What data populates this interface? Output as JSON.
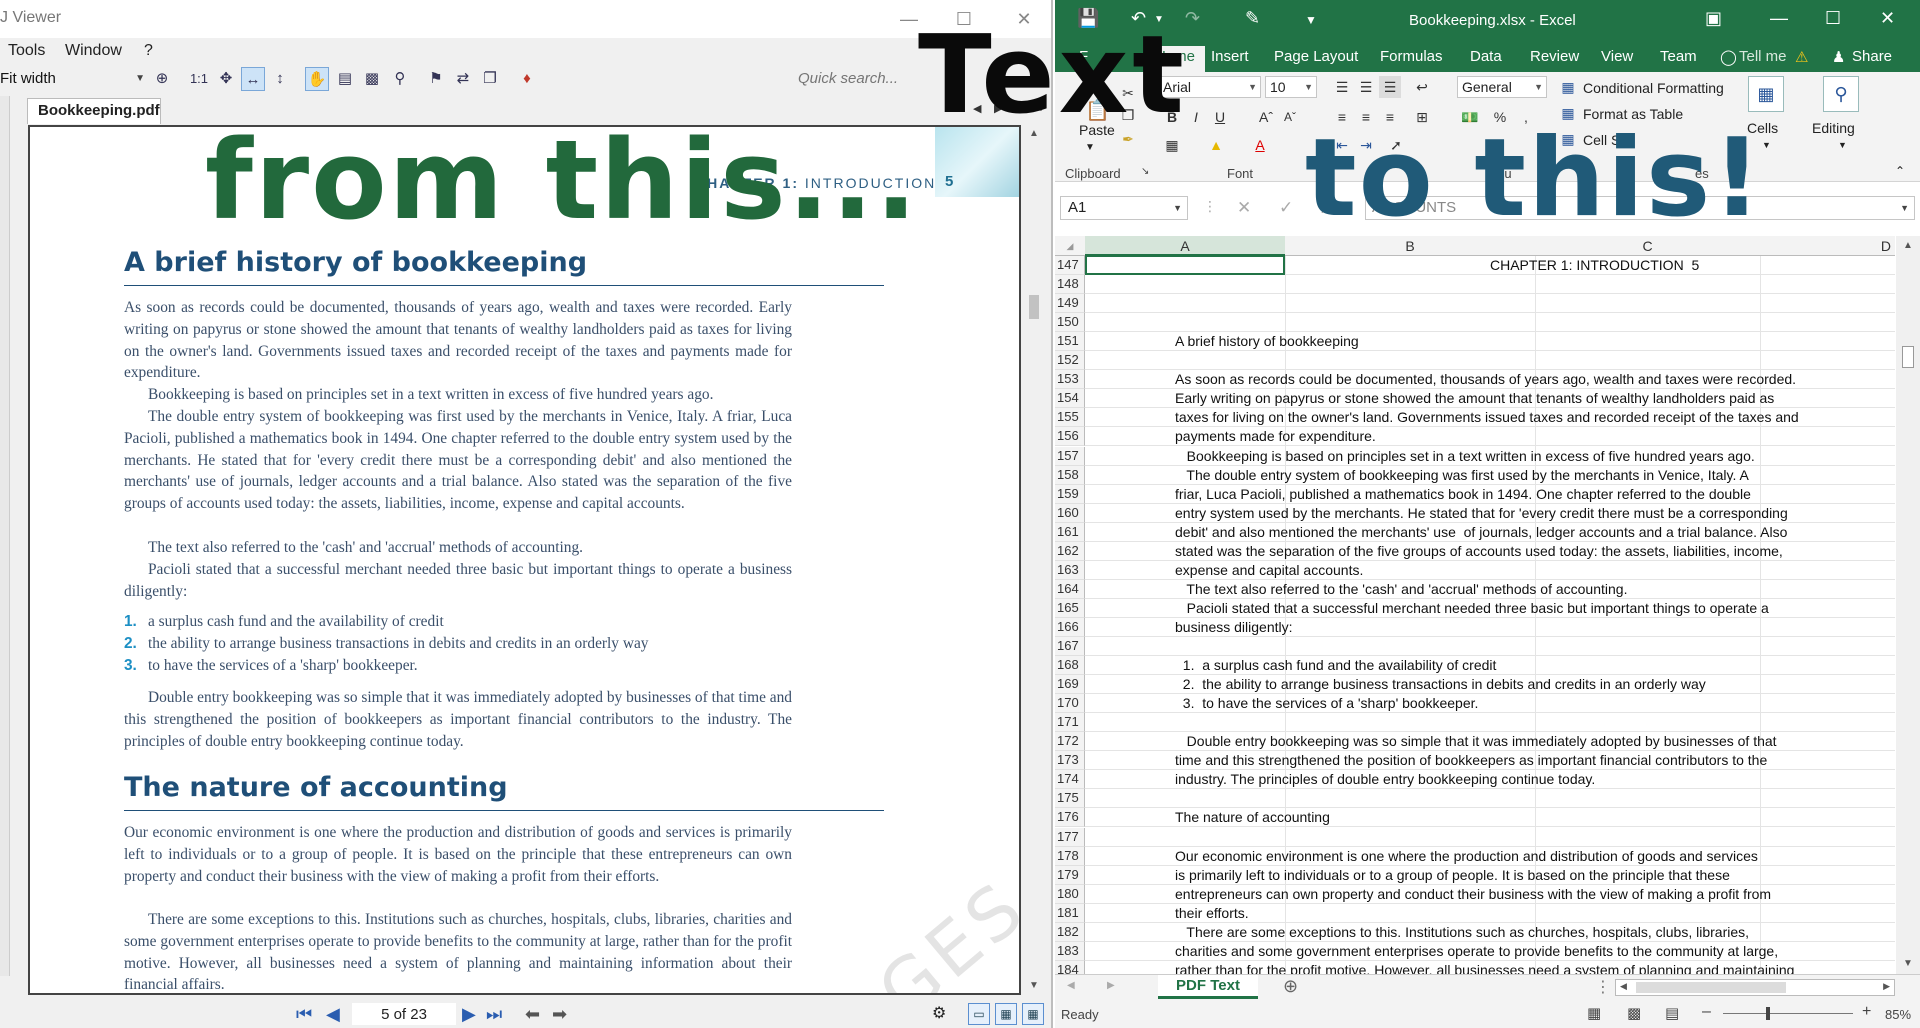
{
  "pdf_viewer": {
    "title": "J Viewer",
    "menu": [
      "Tools",
      "Window",
      "?"
    ],
    "zoom_mode": "Fit width",
    "zoom_ratio": "1:1",
    "search_placeholder": "Quick search...",
    "tab": "Bookkeeping.pdf",
    "page_indicator": "5 of 23",
    "page": {
      "chapter_label": "CHAPTER 1:",
      "chapter_name": "INTRODUCTION",
      "page_number": "5",
      "heading1": "A brief history of bookkeeping",
      "p1": "As soon as records could be documented, thousands of years ago, wealth and taxes were recorded. Early writing on papyrus or stone showed the amount that tenants of wealthy landholders paid as taxes for living on the owner's land. Governments issued taxes and recorded receipt of the taxes and payments made for expenditure.",
      "p2": "Bookkeeping is based on principles set in a text written in excess of five hundred years ago.",
      "p3": "The double entry system of bookkeeping was first used by the merchants in Venice, Italy. A friar, Luca Pacioli, published a mathematics book in 1494. One chapter referred to the double entry system used by the merchants. He stated that for 'every credit there must be a corresponding debit' and also mentioned the merchants' use of journals, ledger accounts and a trial balance. Also stated was the separation of the five groups of accounts used today: the assets, liabilities, income, expense and capital accounts.",
      "p4": "The text also referred to the 'cash' and 'accrual' methods of accounting.",
      "p5": "Pacioli stated that a successful merchant needed three basic but important things to operate a business diligently:",
      "list": [
        {
          "n": "1.",
          "text": "a surplus cash fund and the availability of credit"
        },
        {
          "n": "2.",
          "text": "the ability to arrange business transactions in debits and credits in an orderly way"
        },
        {
          "n": "3.",
          "text": "to have the services of a 'sharp' bookkeeper."
        }
      ],
      "p6": "Double entry bookkeeping was so simple that it was immediately adopted by businesses of that time and this strengthened the position of bookkeepers as important financial contributors to the industry. The principles of double entry bookkeeping continue today.",
      "heading2": "The nature of accounting",
      "p7": "Our economic environment is one where the production and distribution of goods and services is primarily left to individuals or to a group of people. It is based on the principle that these entrepreneurs can own property and conduct their business with the view of making a profit from their efforts.",
      "p8": "There are some exceptions to this. Institutions such as churches, hospitals, clubs, libraries, charities and some government enterprises operate to provide benefits to the community at large, rather than for the profit motive. However, all businesses need a system of planning and maintaining information about their financial affairs.",
      "watermark": "GES"
    }
  },
  "excel": {
    "filename": "Bookkeeping.xlsx - Excel",
    "tabs": [
      "F",
      "Home",
      "Insert",
      "Page Layout",
      "Formulas",
      "Data",
      "Review",
      "View",
      "Team"
    ],
    "tell_me": "Tell me",
    "share": "Share",
    "ribbon": {
      "paste": "Paste",
      "clipboard": "Clipboard",
      "font_name": "Arial",
      "font_size": "10",
      "font_group": "Font",
      "number_format": "General",
      "number_group_partial": "Nu",
      "conditional_formatting": "Conditional Formatting",
      "format_as_table": "Format as Table",
      "cell_styles": "Cell Styl",
      "styles_group_partial": "es",
      "cells": "Cells",
      "editing": "Editing"
    },
    "name_box": "A1",
    "formula_content": "ACCOUNTS",
    "columns": [
      "A",
      "B",
      "C",
      "D"
    ],
    "rows": [
      {
        "n": "147",
        "text": "CHAPTER 1: INTRODUCTION  5",
        "right": true
      },
      {
        "n": "148",
        "text": ""
      },
      {
        "n": "149",
        "text": ""
      },
      {
        "n": "150",
        "text": ""
      },
      {
        "n": "151",
        "text": "A brief history of bookkeeping"
      },
      {
        "n": "152",
        "text": ""
      },
      {
        "n": "153",
        "text": "As soon as records could be documented, thousands of years ago, wealth and taxes were recorded."
      },
      {
        "n": "154",
        "text": "Early writing on papyrus or stone showed the amount that tenants of wealthy landholders paid as"
      },
      {
        "n": "155",
        "text": "taxes for living on the owner's land. Governments issued taxes and recorded receipt of the taxes and"
      },
      {
        "n": "156",
        "text": "payments made for expenditure."
      },
      {
        "n": "157",
        "text": "   Bookkeeping is based on principles set in a text written in excess of five hundred years ago."
      },
      {
        "n": "158",
        "text": "   The double entry system of bookkeeping was first used by the merchants in Venice, Italy. A"
      },
      {
        "n": "159",
        "text": "friar, Luca Pacioli, published a mathematics book in 1494. One chapter referred to the double"
      },
      {
        "n": "160",
        "text": "entry system used by the merchants. He stated that for 'every credit there must be a corresponding"
      },
      {
        "n": "161",
        "text": "debit' and also mentioned the merchants' use  of journals, ledger accounts and a trial balance. Also"
      },
      {
        "n": "162",
        "text": "stated was the separation of the five groups of accounts used today: the assets, liabilities, income,"
      },
      {
        "n": "163",
        "text": "expense and capital accounts."
      },
      {
        "n": "164",
        "text": "   The text also referred to the 'cash' and 'accrual' methods of accounting."
      },
      {
        "n": "165",
        "text": "   Pacioli stated that a successful merchant needed three basic but important things to operate a"
      },
      {
        "n": "166",
        "text": "business diligently:"
      },
      {
        "n": "167",
        "text": ""
      },
      {
        "n": "168",
        "text": "  1.  a surplus cash fund and the availability of credit"
      },
      {
        "n": "169",
        "text": "  2.  the ability to arrange business transactions in debits and credits in an orderly way"
      },
      {
        "n": "170",
        "text": "  3.  to have the services of a 'sharp' bookkeeper."
      },
      {
        "n": "171",
        "text": ""
      },
      {
        "n": "172",
        "text": "   Double entry bookkeeping was so simple that it was immediately adopted by businesses of that"
      },
      {
        "n": "173",
        "text": "time and this strengthened the position of bookkeepers as important financial contributors to the"
      },
      {
        "n": "174",
        "text": "industry. The principles of double entry bookkeeping continue today."
      },
      {
        "n": "175",
        "text": ""
      },
      {
        "n": "176",
        "text": "The nature of accounting"
      },
      {
        "n": "177",
        "text": ""
      },
      {
        "n": "178",
        "text": "Our economic environment is one where the production and distribution of goods and services"
      },
      {
        "n": "179",
        "text": "is primarily left to individuals or to a group of people. It is based on the principle that these"
      },
      {
        "n": "180",
        "text": "entrepreneurs can own property and conduct their business with the view of making a profit from"
      },
      {
        "n": "181",
        "text": "their efforts."
      },
      {
        "n": "182",
        "text": "   There are some exceptions to this. Institutions such as churches, hospitals, clubs, libraries,"
      },
      {
        "n": "183",
        "text": "charities and some government enterprises operate to provide benefits to the community at large,"
      },
      {
        "n": "184",
        "text": "rather than for the profit motive. However, all businesses need a system of planning and maintaining"
      }
    ],
    "sheet_tab": "PDF Text",
    "status": "Ready",
    "zoom": "85%"
  },
  "overlay": {
    "from": "from this...",
    "text": "Text",
    "to": "to this!"
  },
  "colors": {
    "excel_green": "#217346",
    "pdf_heading": "#1f4f78",
    "overlay_from": "#22693c",
    "overlay_to": "#205a78"
  }
}
